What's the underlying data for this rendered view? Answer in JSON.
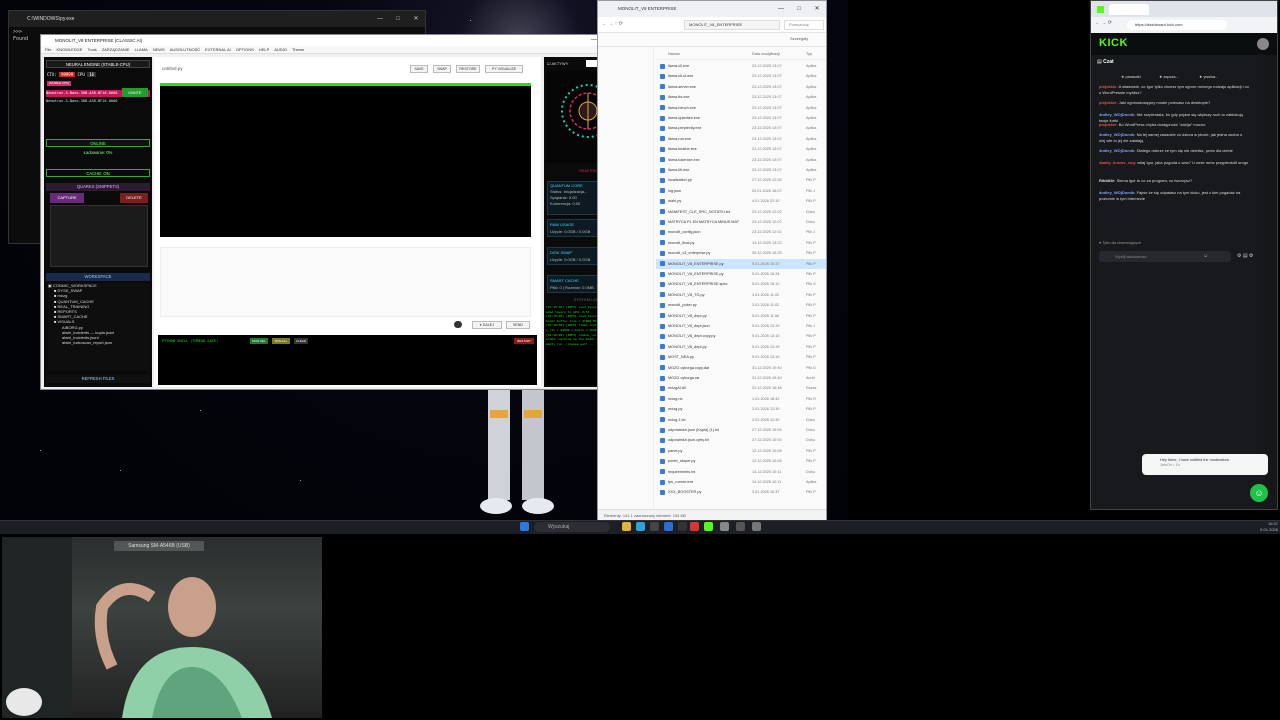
{
  "taskbar": {
    "search_placeholder": "Wyszukaj",
    "time": "16:37",
    "date": "5.01.2026"
  },
  "cmd": {
    "title": "C:\\WINDOWS\\py.exe",
    "lines": [
      ">>> ",
      "Found"
    ]
  },
  "app": {
    "title": "MONOLIT_V8 ENTERPRISE (CLASSIC AI)",
    "menu": [
      "File",
      "KNOWLEDGE",
      "Tools",
      "ZARZĄDZANIE",
      "LLAMA",
      "NEWS",
      "AUSOLUTNOŚĆ",
      "EXTERNAL AI",
      "OPTIONS",
      "HELP",
      "AUDIO",
      "Theme"
    ],
    "left": {
      "engine_header": "NEURAL ENGINE (STABLE-CPU)",
      "ctx_label": "CTX:",
      "ctx_value": "99999",
      "cpu_label": "CPU",
      "cpu_value": "16",
      "stable_badge": "[STABLE CPU]",
      "models": [
        "Nemotron-3-Nano-30B-A3B-BF16-0000",
        "Nemotron-3-Nano-30B-A3B-BF16-0000"
      ],
      "ignite": "IGNITE",
      "online": "ONLINE",
      "loading": "Ładowanie: 0%",
      "cache": "CACHE: ON",
      "quarks_header": "QUARKS (SNIPPETS)",
      "capture": "CAPTURE",
      "delete": "DELETE",
      "workspace_header": "WORKSPACE",
      "tree": [
        "COSMIC_WORKSPACE",
        "DYSK_SWAP",
        "mózg",
        "QUANTUM_CACHE",
        "REAL_TRAINING",
        "REPORTS",
        "SMART_CACHE",
        "VISUALS",
        "AIBORG.py",
        "aiwiri_incidents — kopia.jsonl",
        "aiwiri_incidents.jsonl",
        "aiwiri_turboscan_report.json"
      ],
      "refresh": "REFRESH FILES"
    },
    "center": {
      "filename": "untitled.py",
      "buttons": [
        "SAVE",
        "SNAP",
        "RESTORE",
        "PY VISUALIZE"
      ],
      "dalej": "DALEJ",
      "send": "SEND",
      "shell_label": "PYTHON SHELL (THREAD SAFE)",
      "run_sel": "RUN SEL",
      "run_all": "RUN ALL",
      "clear": "CLEAR",
      "restart": "RESTART"
    },
    "right": {
      "aktiv": "AKTYWY",
      "auto": "AUT",
      "reactor_label": "REAKTOR",
      "quantum_core": "QUANTUM CORE",
      "q_status": "Status: Inicjalizacja...",
      "q_splatanie": "Splątanie: 0.00",
      "q_koherencja": "Koherencja: 0.00",
      "ram_usage": "RAM USAGE",
      "ram_value": "Użycie: 0.0GB / 0.0GB",
      "disk_swap": "DISK SWAP",
      "disk_value": "Użycie: 0.0GB / 0.0GB",
      "smart_cache": "SMART CACHE",
      "smart_value": "Pliki: 0 | Rozmiar: 0.0MB",
      "system_logs": "SYSTEM LOGS",
      "logs": [
        "[01:10:00] [INFO] load_tensors: offlo",
        "aded layers to GPU: 0/53",
        "[01:10:00] [INFO] load_tensors: CPU",
        "model buffer size = 47000 MiB",
        "[01:10:00] [INFO] llama_context:",
        "n_ctx = 99999 n_batch = 2048",
        "[01:10:00] [INFO] common_init_from_p",
        "arams: warming up the model with an",
        "empty run - please wait ..."
      ]
    }
  },
  "explorer": {
    "title": "MONOLIT_V8 ENTERPRISE",
    "path": "MONOLIT_V8_ENTERPRISE",
    "search": "Przeszukaj",
    "sort_label": "Szczegóły",
    "col_name": "Nazwa",
    "col_date": "Data modyfikacji",
    "col_type": "Typ",
    "files": [
      {
        "n": "llama-cli.exe",
        "d": "23.12.2025 13:07",
        "t": "Aplika"
      },
      {
        "n": "llama-cli-ui.exe",
        "d": "23.12.2025 13:07",
        "t": "Aplika"
      },
      {
        "n": "llama-server.exe",
        "d": "23.12.2025 13:07",
        "t": "Aplika"
      },
      {
        "n": "llama-tts.exe",
        "d": "23.12.2025 13:07",
        "t": "Aplika"
      },
      {
        "n": "llama-bench.exe",
        "d": "23.12.2025 13:07",
        "t": "Aplika"
      },
      {
        "n": "llama-quantize.exe",
        "d": "23.12.2025 13:07",
        "t": "Aplika"
      },
      {
        "n": "llama-perplexity.exe",
        "d": "23.12.2025 13:07",
        "t": "Aplika"
      },
      {
        "n": "llama-run.exe",
        "d": "23.12.2025 13:07",
        "t": "Aplika"
      },
      {
        "n": "llama-imatrix.exe",
        "d": "23.12.2025 13:07",
        "t": "Aplika"
      },
      {
        "n": "llama-tokenize.exe",
        "d": "23.12.2025 13:07",
        "t": "Aplika"
      },
      {
        "n": "llama-lib.exe",
        "d": "23.12.2025 13:07",
        "t": "Aplika"
      },
      {
        "n": "localization.py",
        "d": "27.12.2025 12:26",
        "t": "Plik P"
      },
      {
        "n": "log.json",
        "d": "02.01.2026 16:07",
        "t": "Plik J"
      },
      {
        "n": "main.py",
        "d": "4.01.2026 22:10",
        "t": "Plik P"
      },
      {
        "n": "MANIFEST_CLE_SRC_NOTATKI.txt",
        "d": "23.12.2025 12:02",
        "t": "Doku"
      },
      {
        "n": "MATRYCA PL EN MATRYCA MINUS MAT",
        "d": "23.12.2025 12:02",
        "t": "Doku"
      },
      {
        "n": "monolit_config.json",
        "d": "23.12.2025 12:02",
        "t": "Plik J"
      },
      {
        "n": "monolit_final.py",
        "d": "14.12.2025 13:22",
        "t": "Plik P"
      },
      {
        "n": "monolit_v3_enterprise.py",
        "d": "30.12.2025 16:25",
        "t": "Plik P"
      },
      {
        "n": "MONOLIT_V8_ENTERPRISE.py",
        "d": "5.01.2026 16:37",
        "t": "Plik P"
      },
      {
        "n": "MONOLIT_V8_ENTERPRISE.py",
        "d": "5.01.2026 16:34",
        "t": "Plik P"
      },
      {
        "n": "MONOLIT_V8_ENTERPRISE.spec",
        "d": "5.01.2026 15:10",
        "t": "Plik S"
      },
      {
        "n": "MONOLIT_V8_TG.py",
        "d": "3.01.2026 11:02",
        "t": "Plik P"
      },
      {
        "n": "monolit_poker.py",
        "d": "3.01.2026 11:02",
        "t": "Plik P"
      },
      {
        "n": "MONOLIT_V8_dept.py",
        "d": "5.01.2026 11:56",
        "t": "Plik P"
      },
      {
        "n": "MONOLIT_V8_dept.json",
        "d": "5.01.2026 13:15",
        "t": "Plik J"
      },
      {
        "n": "MONOLIT_V8_dept.copy.py",
        "d": "5.01.2026 13:15",
        "t": "Plik P"
      },
      {
        "n": "MONOLIT_V8_dept.py",
        "d": "5.01.2026 13:15",
        "t": "Plik P"
      },
      {
        "n": "MOST_NEA.py",
        "d": "5.01.2026 13:15",
        "t": "Plik P"
      },
      {
        "n": "MOZG cyborga.copy.dat",
        "d": "31.12.2025 19:40",
        "t": "Plik D"
      },
      {
        "n": "MOZG cyborga.rar",
        "d": "31.12.2025 19:40",
        "t": "Archi"
      },
      {
        "n": "mózgAI.dll",
        "d": "22.12.2025 16:48",
        "t": "Rozsz"
      },
      {
        "n": "mózg.rtx",
        "d": "1.01.2026 18:42",
        "t": "Plik R"
      },
      {
        "n": "mózg.py",
        "d": "2.01.2026 12:30",
        "t": "Plik P"
      },
      {
        "n": "mózg.1.txt",
        "d": "2.01.2026 12:30",
        "t": "Doku"
      },
      {
        "n": "odpowiedzi.json (Kopia) (1).txt",
        "d": "27.12.2025 15:04",
        "t": "Doku"
      },
      {
        "n": "odpowiedzi.json.cyfry.txt",
        "d": "27.12.2025 15:04",
        "t": "Doku"
      },
      {
        "n": "panel.py",
        "d": "12.12.2025 10:08",
        "t": "Plik P"
      },
      {
        "n": "porter_stoper.py",
        "d": "12.12.2025 10:08",
        "t": "Plik P"
      },
      {
        "n": "requirements.txt",
        "d": "14.12.2025 10:11",
        "t": "Doku"
      },
      {
        "n": "tpu_runner.exe",
        "d": "14.12.2025 10:11",
        "t": "Aplika"
      },
      {
        "n": "XXX_BOOSTER.py",
        "d": "3.01.2026 10:37",
        "t": "Plik P"
      }
    ],
    "status": "Elementy: 141    1 zaznaczony element: 134 KB"
  },
  "browser": {
    "url": "https://dashboard.kick.com",
    "kick_logo": "KICK",
    "chat_title": "Czat",
    "pinned": [
      "parasolki",
      "zapcza...",
      "ywoisa..."
    ],
    "messages": [
      {
        "u": "piojokkie:",
        "t": "A właściwie, co Igor tylko chcesz tym ogrom różnego rodzaju aplikacji i co o WordPressie myślisz?",
        "c": "#e05252"
      },
      {
        "u": "piojokkie:",
        "t": "Jaki ogólnodostępny model polecasz na desktopie?",
        "c": "#e05252"
      },
      {
        "u": "4ndley_WOjDomik:",
        "t": "Nie rozpierdala, bo gdy pojawi się większy ruch to zablokują twoje furtki",
        "c": "#7aa7ff"
      },
      {
        "u": "piojokkie:",
        "t": "Bo WordPress chyba dostępność \"zabija\" mocno",
        "c": "#e05252"
      },
      {
        "u": "4ndley_WOjDomik:",
        "t": "Na tej samej zasadzie co dziura w płocie, jak jedna osoba o niej wie to jej nie załatają",
        "c": "#7aa7ff"
      },
      {
        "u": "4ndley_WOjDomik:",
        "t": "Dlatego dobrze że tym się nie dzielisz, proto dla ciebie",
        "c": "#7aa7ff"
      },
      {
        "u": "daddy_knows_cog:",
        "t": "witaj Igor, jaka pogoda u was? U mnie mróz przypierdolił srogo",
        "c": "#e05252"
      },
      {
        "u": "Ribbit3r:",
        "t": "Siema igor to co za program, co tworzysz?",
        "c": "#dddddd"
      },
      {
        "u": "4ndley_WOjDomik:",
        "t": "Fajnie że się odpalasz na tym kicku, jest z kim pogadać na poziomie w tym internecie",
        "c": "#7aa7ff"
      }
    ],
    "followers_only": "Tylko dla obserwujących",
    "chat_placeholder": "Wyślij wiadomość",
    "toast_line1": "Hey there, I have notified the moderators",
    "toast_line2": "JetsOn • 1h"
  },
  "webcam": {
    "label": "Samsung SM-A546B (USB)"
  },
  "colors": {
    "kick_green": "#53fc18",
    "engine_red": "#e0246e",
    "term_green": "#19e619",
    "accent_blue": "#2a6fd6"
  }
}
